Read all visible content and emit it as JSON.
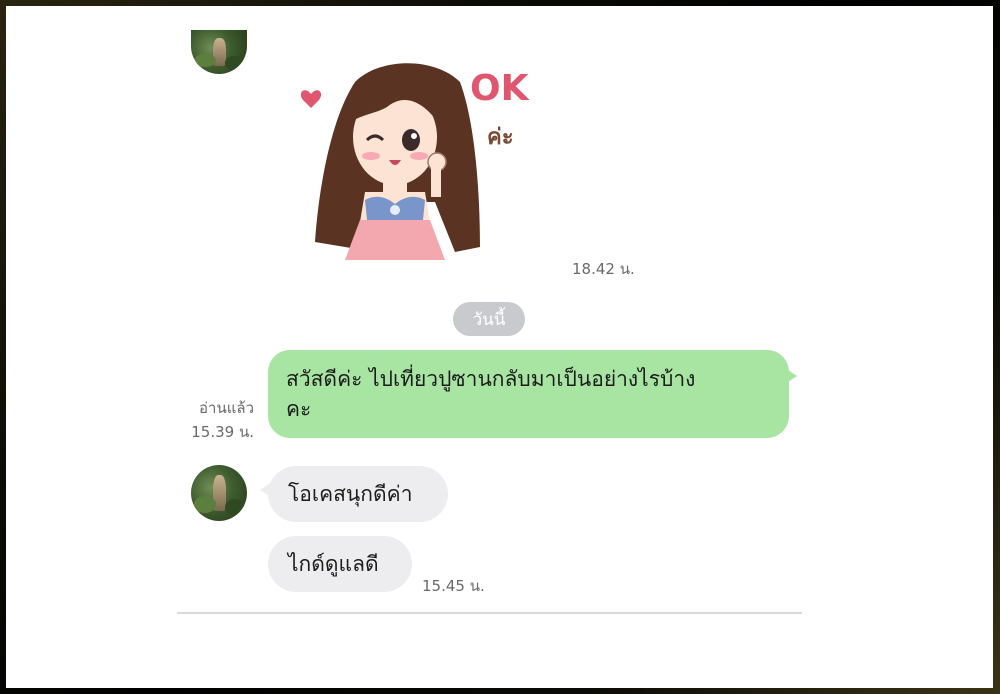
{
  "chat": {
    "sticker": {
      "text_ok": "OK",
      "text_ka": "ค่ะ",
      "time": "18.42 น."
    },
    "day_separator": "วันนี้",
    "outgoing": {
      "text_line1": "สวัสดีค่ะ  ไปเที่ยวปูซานกลับมาเป็นอย่างไรบ้าง",
      "text_line2": "คะ",
      "read_label": "อ่านแล้ว",
      "time": "15.39 น."
    },
    "incoming": [
      {
        "text": "โอเคสนุกดีค่า"
      },
      {
        "text": "ไกด์ดูแลดี",
        "time": "15.45 น."
      }
    ]
  },
  "colors": {
    "outgoing_bubble": "#a8e5a2",
    "incoming_bubble": "#ededef",
    "day_pill": "#c8cace",
    "sticker_text": "#e0566f"
  },
  "icons": [
    "contact-avatar",
    "sticker-ok-girl"
  ]
}
